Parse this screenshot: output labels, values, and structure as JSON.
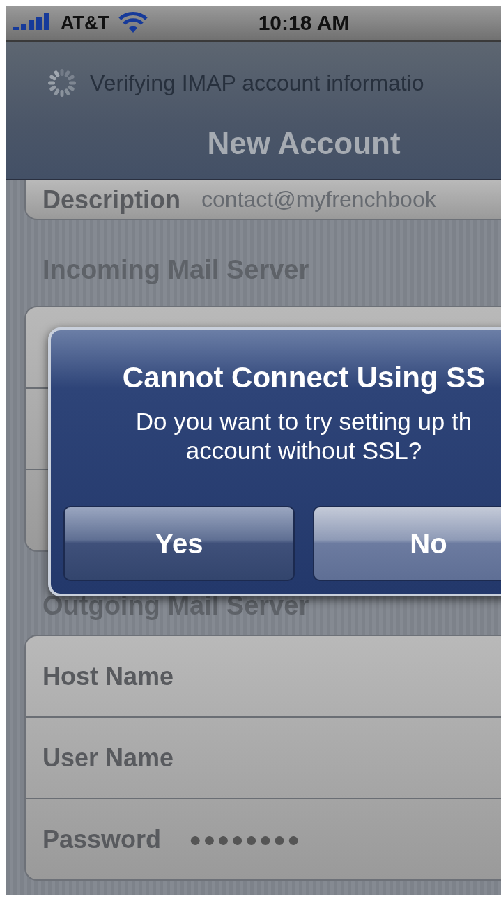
{
  "status_bar": {
    "carrier": "AT&T",
    "time": "10:18 AM"
  },
  "prompt": "Verifying IMAP account informatio",
  "nav_title": "New Account",
  "description_row": {
    "label": "Description",
    "value": "contact@myfrenchbook"
  },
  "incoming": {
    "header": "Incoming Mail Server"
  },
  "outgoing": {
    "header": "Outgoing Mail Server",
    "rows": [
      {
        "label": "Host Name"
      },
      {
        "label": "User Name"
      },
      {
        "label": "Password",
        "value": "●●●●●●●●"
      }
    ]
  },
  "alert": {
    "title": "Cannot Connect Using SS",
    "message": "Do you want to try setting up th\naccount without SSL?",
    "buttons": [
      "Yes",
      "No"
    ]
  }
}
